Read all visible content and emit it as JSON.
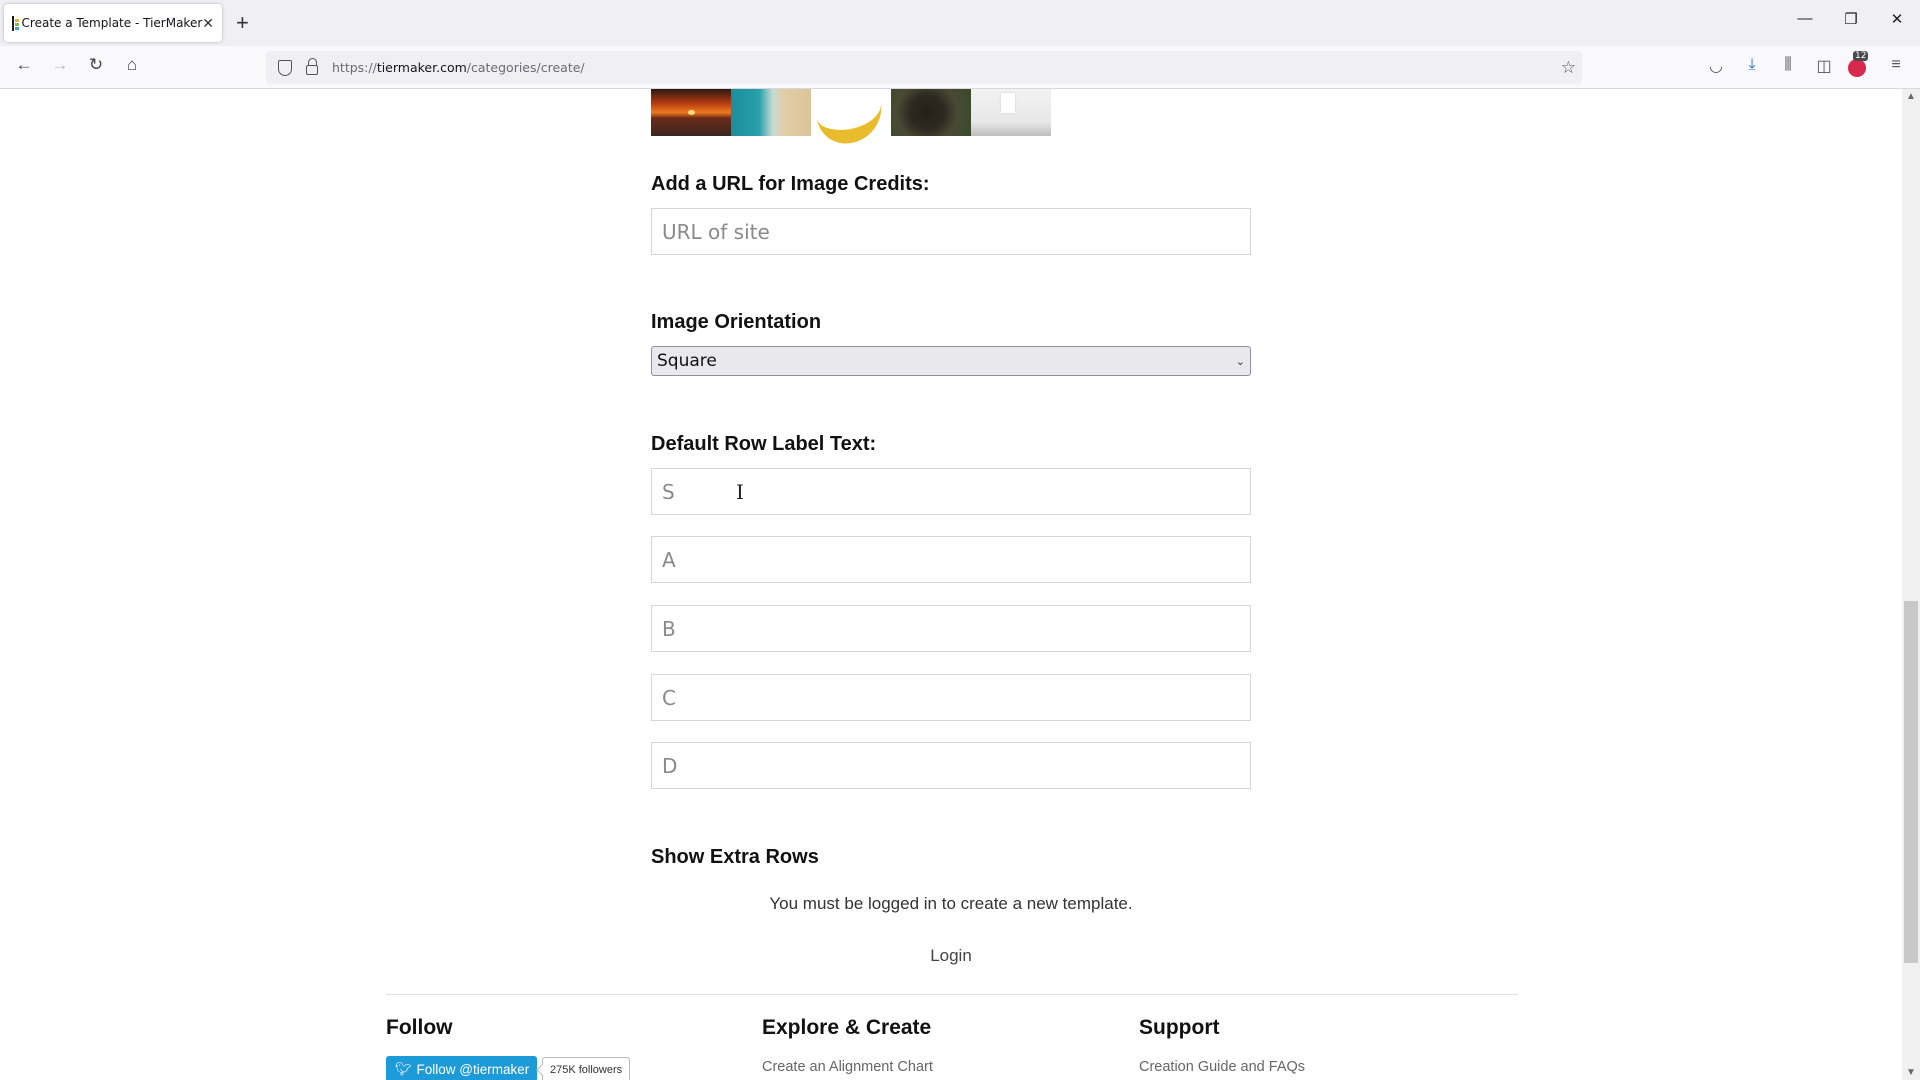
{
  "browser": {
    "tab_title": "Create a Template - TierMaker",
    "new_tab_icon": "plus-icon",
    "url_host": "tiermaker.com",
    "url_prefix": "https://",
    "url_path": "/categories/create/",
    "extension_badge": "12",
    "window_controls": [
      "minimize",
      "restore",
      "close"
    ]
  },
  "form": {
    "image_thumbnails": [
      "sunset",
      "beach",
      "banana",
      "bear",
      "room"
    ],
    "credits_label": "Add a URL for Image Credits:",
    "credits_placeholder": "URL of site",
    "orientation_label": "Image Orientation",
    "orientation_value": "Square",
    "row_label_heading": "Default Row Label Text:",
    "row_labels": [
      "S",
      "A",
      "B",
      "C",
      "D"
    ],
    "extra_rows_label": "Show Extra Rows",
    "login_message": "You must be logged in to create a new template.",
    "login_link": "Login"
  },
  "footer": {
    "follow_heading": "Follow",
    "twitter_button": "Follow @tiermaker",
    "twitter_followers": "275K followers",
    "explore_heading": "Explore & Create",
    "explore_links": [
      "Create an Alignment Chart"
    ],
    "support_heading": "Support",
    "support_links": [
      "Creation Guide and FAQs"
    ]
  },
  "colors": {
    "twitter_blue": "#1d9bd9",
    "abp_red": "#d8284c"
  }
}
